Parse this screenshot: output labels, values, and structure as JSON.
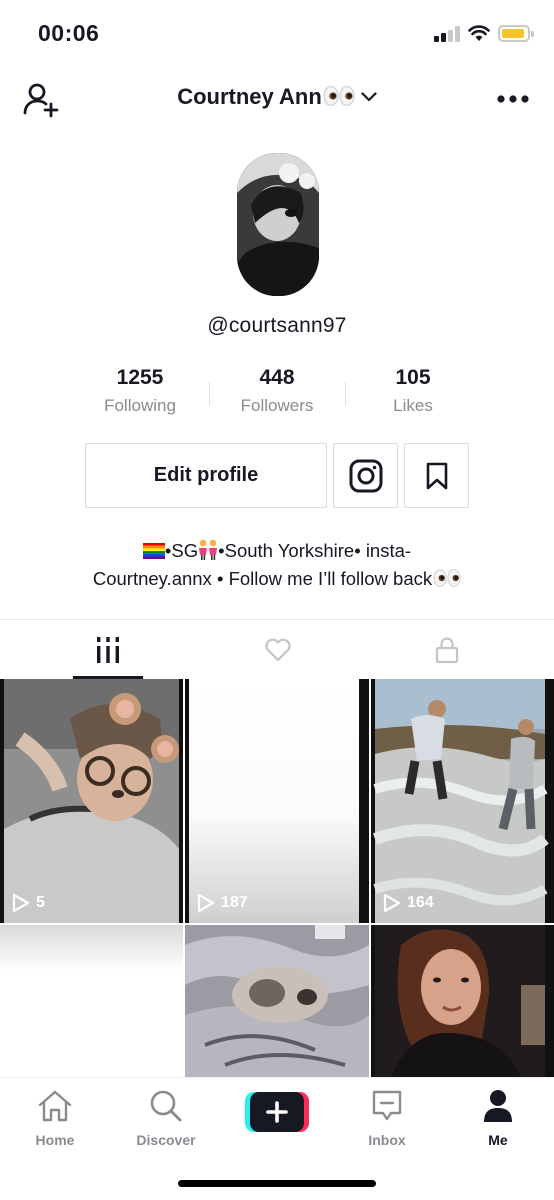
{
  "status_bar": {
    "time": "00:06",
    "battery_color": "#f7c529"
  },
  "header": {
    "title": "Courtney Ann",
    "title_emoji": "eyes-emoji",
    "add_user_icon": "add-user-icon",
    "more_icon": "more-dots-icon"
  },
  "profile": {
    "handle": "@courtsann97",
    "stats": [
      {
        "value": "1255",
        "label": "Following"
      },
      {
        "value": "448",
        "label": "Followers"
      },
      {
        "value": "105",
        "label": "Likes"
      }
    ],
    "edit_button": "Edit profile",
    "bio_line1_a": "•SG",
    "bio_line1_b": "•South Yorkshire• insta-",
    "bio_line2": "Courtney.annx • Follow me I’ll follow back"
  },
  "tabs": [
    {
      "icon": "grid-icon",
      "active": true
    },
    {
      "icon": "heart-icon",
      "active": false
    },
    {
      "icon": "lock-icon",
      "active": false
    }
  ],
  "videos": [
    {
      "views": "5"
    },
    {
      "views": "187"
    },
    {
      "views": "164"
    }
  ],
  "bottom_nav": [
    {
      "label": "Home",
      "icon": "home-icon"
    },
    {
      "label": "Discover",
      "icon": "search-icon"
    },
    {
      "label": "",
      "icon": "plus-icon"
    },
    {
      "label": "Inbox",
      "icon": "inbox-icon"
    },
    {
      "label": "Me",
      "icon": "person-icon",
      "active": true
    }
  ],
  "colors": {
    "text": "#161823",
    "muted": "#8a8b91",
    "accent_cyan": "#25f4ee",
    "accent_pink": "#fe2c55"
  }
}
